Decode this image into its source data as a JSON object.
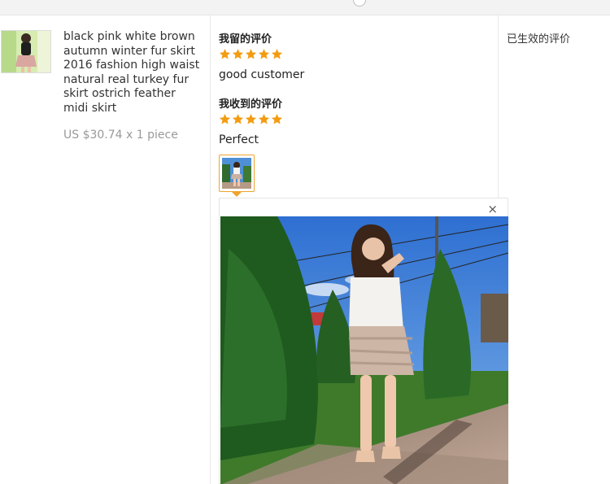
{
  "product": {
    "title": "black pink white brown autumn winter fur skirt 2016 fashion high waist natural real turkey fur skirt ostrich feather midi skirt",
    "price": "US $30.74 x 1 piece"
  },
  "feedback": {
    "given_label": "我留的评价",
    "given_rating": 5,
    "given_text": "good customer",
    "received_label": "我收到的评价",
    "received_rating": 5,
    "received_text": "Perfect"
  },
  "status": {
    "text": "已生效的评价"
  },
  "viewer": {
    "close_symbol": "×"
  },
  "colors": {
    "star": "#f39c12",
    "thumb_border": "#f0a32d",
    "price": "#999999"
  }
}
